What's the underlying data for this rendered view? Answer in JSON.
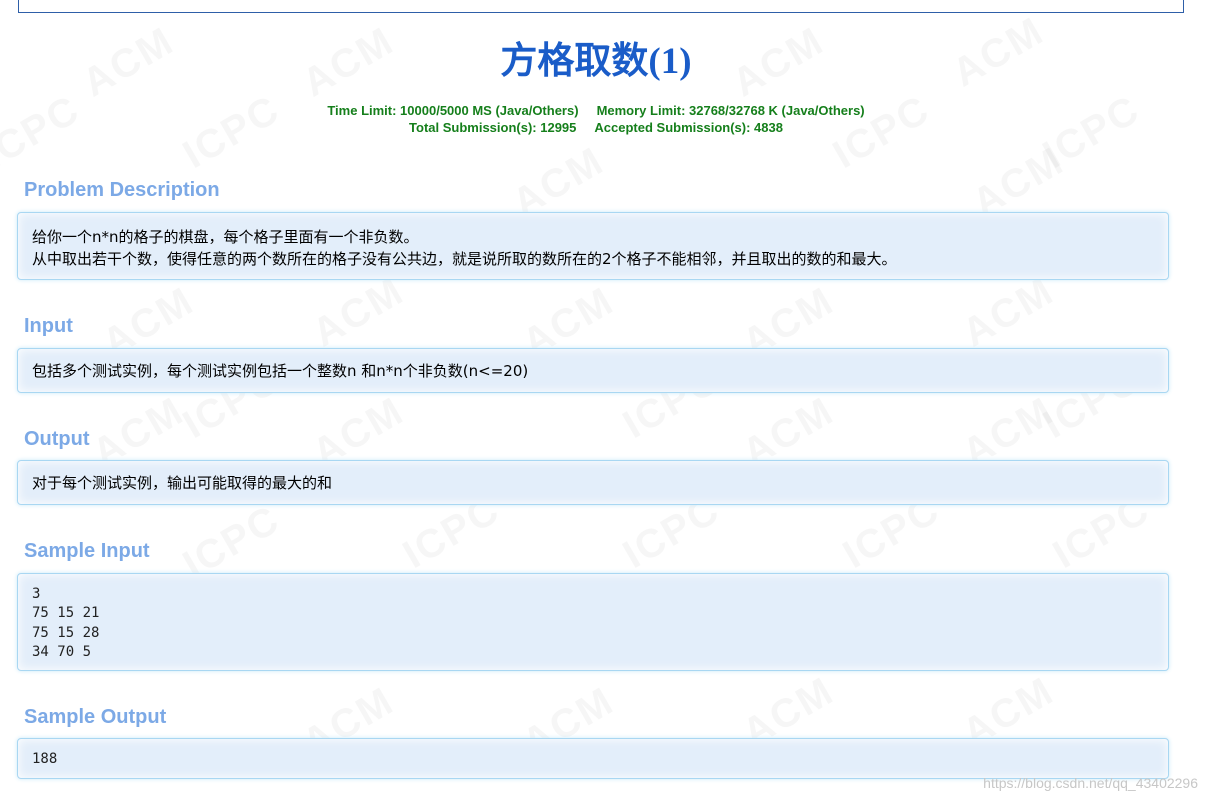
{
  "problem": {
    "title_cn": "方格取数",
    "title_num": "(1)",
    "time_limit": "Time Limit: 10000/5000 MS (Java/Others)",
    "memory_limit": "Memory Limit: 32768/32768 K (Java/Others)",
    "total_submissions": "Total Submission(s): 12995",
    "accepted_submissions": "Accepted Submission(s): 4838"
  },
  "sections": {
    "description_title": "Problem Description",
    "description_line1": "给你一个n*n的格子的棋盘，每个格子里面有一个非负数。",
    "description_line2": "从中取出若干个数，使得任意的两个数所在的格子没有公共边，就是说所取的数所在的2个格子不能相邻，并且取出的数的和最大。",
    "input_title": "Input",
    "input_text": "包括多个测试实例，每个测试实例包括一个整数n 和n*n个非负数(n<=20)",
    "output_title": "Output",
    "output_text": "对于每个测试实例，输出可能取得的最大的和",
    "sample_input_title": "Sample Input",
    "sample_input": "3\n75 15 21\n75 15 28\n34 70 5",
    "sample_output_title": "Sample Output",
    "sample_output": "188"
  },
  "watermark": {
    "text_acm": "ACM",
    "text_icpc": "ICPC"
  },
  "footer": {
    "credit": "https://blog.csdn.net/qq_43402296"
  },
  "colors": {
    "title": "#1a5cc8",
    "limits": "#157f1b",
    "section_title": "#7ca9e6",
    "panel_bg": "#e3eefa",
    "panel_border": "#a9d7f2"
  }
}
